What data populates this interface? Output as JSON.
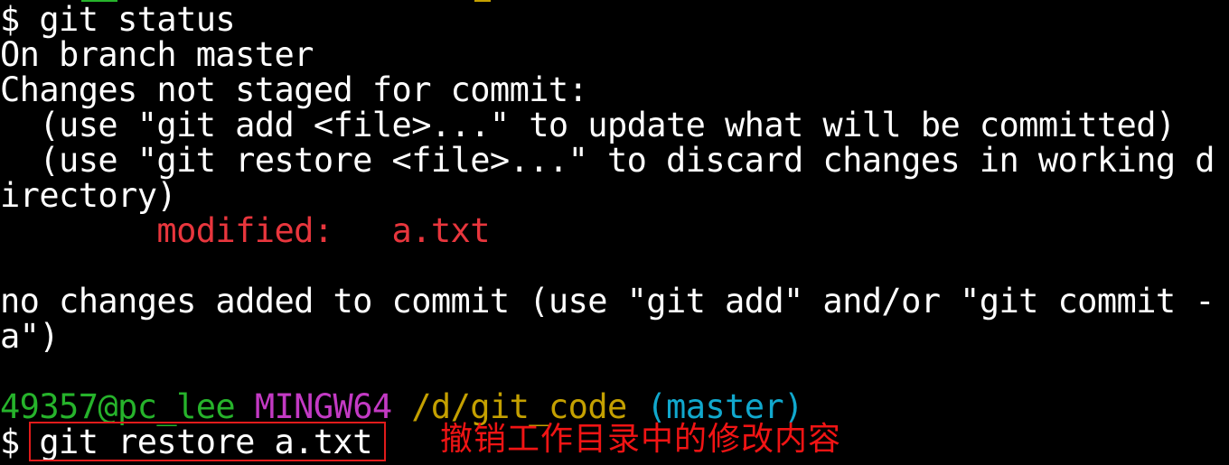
{
  "terminal": {
    "lines": {
      "cmd_status": "$ git status",
      "branch": "On branch master",
      "changes_header": "Changes not staged for commit:",
      "hint_add": "  (use \"git add <file>...\" to update what will be committed)",
      "hint_restore_1": "  (use \"git restore <file>...\" to discard changes in working d",
      "hint_restore_2": "irectory)",
      "modified_label": "        modified:   a.txt",
      "no_changes_1": "no changes added to commit (use \"git add\" and/or \"git commit -",
      "no_changes_2": "a\")"
    },
    "prompt": {
      "user_host": "49357@pc_lee",
      "env": "MINGW64",
      "path": "/d/git_code",
      "branch": "(master)"
    },
    "input": {
      "dollar": "$",
      "command": "git restore a.txt"
    },
    "annotation": "撤销工作目录中的修改内容"
  },
  "colors": {
    "background": "#000000",
    "text": "#ffffff",
    "modified": "#e8363d",
    "user_host": "#26b32b",
    "env": "#c33ac4",
    "path": "#c4a000",
    "branch": "#11a8cd",
    "annotation": "#f01414"
  }
}
